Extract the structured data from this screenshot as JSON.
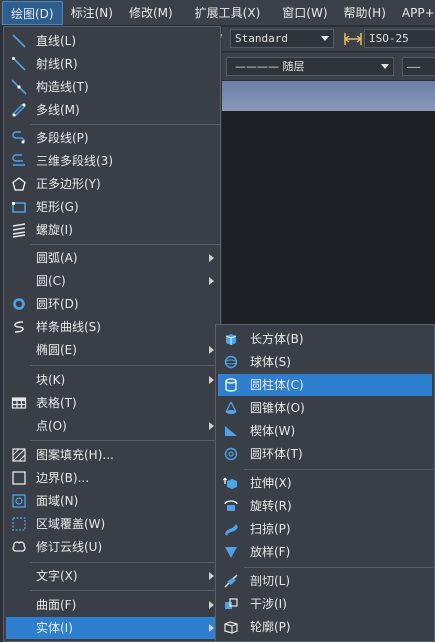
{
  "menubar": {
    "items": [
      "绘图(D)",
      "标注(N)",
      "修改(M)",
      "扩展工具(X)",
      "窗口(W)",
      "帮助(H)",
      "APP+"
    ]
  },
  "toolbar": {
    "text_style": "Standard",
    "dim_style": "ISO-25",
    "layer": "———— 随层",
    "linetype_prefix": "——"
  },
  "draw_menu": {
    "items": [
      {
        "label": "直线(L)",
        "icon": "line-icon"
      },
      {
        "label": "射线(R)",
        "icon": "ray-icon"
      },
      {
        "label": "构造线(T)",
        "icon": "xline-icon"
      },
      {
        "label": "多线(M)",
        "icon": "mline-icon"
      },
      {
        "label": "多段线(P)",
        "icon": "polyline-icon"
      },
      {
        "label": "三维多段线(3)",
        "icon": "3d-polyline-icon"
      },
      {
        "label": "正多边形(Y)",
        "icon": "polygon-icon"
      },
      {
        "label": "矩形(G)",
        "icon": "rectangle-icon"
      },
      {
        "label": "螺旋(I)",
        "icon": "helix-icon"
      },
      {
        "label": "圆弧(A)",
        "icon": ""
      },
      {
        "label": "圆(C)",
        "icon": ""
      },
      {
        "label": "圆环(D)",
        "icon": "donut-icon"
      },
      {
        "label": "样条曲线(S)",
        "icon": "spline-icon"
      },
      {
        "label": "椭圆(E)",
        "icon": ""
      },
      {
        "label": "块(K)",
        "icon": ""
      },
      {
        "label": "表格(T)",
        "icon": "table-icon"
      },
      {
        "label": "点(O)",
        "icon": ""
      },
      {
        "label": "图案填充(H)...",
        "icon": "hatch-icon"
      },
      {
        "label": "边界(B)...",
        "icon": "boundary-icon"
      },
      {
        "label": "面域(N)",
        "icon": "region-icon"
      },
      {
        "label": "区域覆盖(W)",
        "icon": "wipeout-icon"
      },
      {
        "label": "修订云线(U)",
        "icon": "revcloud-icon"
      },
      {
        "label": "文字(X)",
        "icon": ""
      },
      {
        "label": "曲面(F)",
        "icon": ""
      },
      {
        "label": "实体(I)",
        "icon": ""
      }
    ]
  },
  "solid_submenu": {
    "items": [
      {
        "label": "长方体(B)",
        "icon": "box-icon"
      },
      {
        "label": "球体(S)",
        "icon": "sphere-icon"
      },
      {
        "label": "圆柱体(C)",
        "icon": "cylinder-icon"
      },
      {
        "label": "圆锥体(O)",
        "icon": "cone-icon"
      },
      {
        "label": "楔体(W)",
        "icon": "wedge-icon"
      },
      {
        "label": "圆环体(T)",
        "icon": "torus-icon"
      },
      {
        "label": "拉伸(X)",
        "icon": "extrude-icon"
      },
      {
        "label": "旋转(R)",
        "icon": "revolve-icon"
      },
      {
        "label": "扫掠(P)",
        "icon": "sweep-icon"
      },
      {
        "label": "放样(F)",
        "icon": "loft-icon"
      },
      {
        "label": "剖切(L)",
        "icon": "slice-icon"
      },
      {
        "label": "干涉(I)",
        "icon": "interfere-icon"
      },
      {
        "label": "轮廓(P)",
        "icon": "profile-icon"
      }
    ]
  }
}
